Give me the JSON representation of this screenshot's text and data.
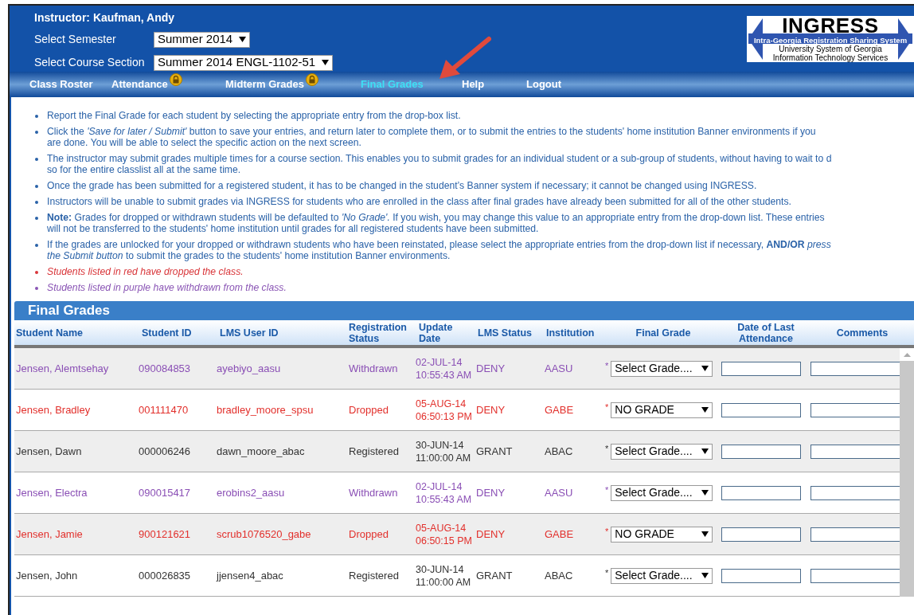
{
  "header": {
    "instructor": "Instructor: Kaufman, Andy",
    "semester_label": "Select Semester",
    "semester_value": "Summer 2014",
    "section_label": "Select Course Section",
    "section_value": "Summer 2014 ENGL-1102-51"
  },
  "logo": {
    "title": "INGRESS",
    "subtitle": "Intra-Georgia Registration Sharing System",
    "line_1": "University System of Georgia",
    "line_2": "Information Technology Services"
  },
  "nav": [
    {
      "label": "Class Roster",
      "selected": false,
      "locked": false
    },
    {
      "label": "Attendance",
      "selected": false,
      "locked": true
    },
    {
      "label": "Midterm Grades",
      "selected": false,
      "locked": true
    },
    {
      "label": "Final Grades",
      "selected": true,
      "locked": false
    },
    {
      "label": "Help",
      "selected": false,
      "locked": false
    },
    {
      "label": "Logout",
      "selected": false,
      "locked": false
    }
  ],
  "instructions": [
    {
      "kind": "info",
      "lines": [
        "Report the Final Grade for each student by selecting the appropriate entry from the drop-box list."
      ]
    },
    {
      "kind": "info",
      "lines": [
        "Click the *'Save for later / Submit'* button to save your entries, and return later to complete them, or to submit the entries to the students' home institution Banner environments if you",
        "are done. You will be able to select the specific action on the next screen."
      ]
    },
    {
      "kind": "info",
      "lines": [
        "The instructor may submit grades multiple times for a course section. This enables you to submit grades for an individual student or a sub-group of students, without having to wait to d",
        "so for the entire classlist all at the same time."
      ]
    },
    {
      "kind": "info",
      "lines": [
        "Once the grade has been submitted for a registered student, it has to be changed in the student’s Banner system if necessary; it cannot be changed using INGRESS."
      ]
    },
    {
      "kind": "info",
      "lines": [
        "Instructors will be unable to submit grades via INGRESS for students who are enrolled in the class after final grades have already been submitted for all of the other students."
      ]
    },
    {
      "kind": "info",
      "lines": [
        "**Note:** Grades for dropped or withdrawn students will be defaulted to *'No Grade'.* If you wish, you may change this value to an appropriate entry from the drop-down list. These entries",
        "will not be transferred to the students' home institution until grades for all registered students have been submitted."
      ]
    },
    {
      "kind": "info",
      "lines": [
        "If the grades are unlocked for your dropped or withdrawn students who have been reinstated, please select the appropriate entries from the drop-down list if necessary, **AND/OR** *press*",
        "*the Submit button* to submit the grades to the students' home institution Banner environments."
      ]
    },
    {
      "kind": "dropped",
      "lines": [
        "Students listed in red have dropped the class."
      ]
    },
    {
      "kind": "withdrawn",
      "lines": [
        "Students listed in purple have withdrawn from the class."
      ]
    }
  ],
  "table": {
    "title": "Final Grades",
    "columns": [
      "Student Name",
      "Student ID",
      "LMS User ID",
      "Registration Status",
      "Update Date",
      "LMS Status",
      "Institution",
      "Final Grade",
      "Date of Last Attendance",
      "Comments"
    ],
    "rows": [
      {
        "kind": "withdrawn",
        "name": "Jensen, Alemtsehay",
        "student_id": "090084853",
        "lms_user_id": "ayebiyo_aasu",
        "registration_status": "Withdrawn",
        "update_date": "02-JUL-14 10:55:43 AM",
        "lms_status": "DENY",
        "institution": "AASU",
        "required": "*",
        "final_grade": "Select Grade...."
      },
      {
        "kind": "dropped",
        "name": "Jensen, Bradley",
        "student_id": "001111470",
        "lms_user_id": "bradley_moore_spsu",
        "registration_status": "Dropped",
        "update_date": "05-AUG-14 06:50:13 PM",
        "lms_status": "DENY",
        "institution": "GABE",
        "required": "*",
        "final_grade": "NO GRADE"
      },
      {
        "kind": "registered",
        "name": "Jensen, Dawn",
        "student_id": "000006246",
        "lms_user_id": "dawn_moore_abac",
        "registration_status": "Registered",
        "update_date": "30-JUN-14 11:00:00 AM",
        "lms_status": "GRANT",
        "institution": "ABAC",
        "required": "*",
        "final_grade": "Select Grade...."
      },
      {
        "kind": "withdrawn",
        "name": "Jensen, Electra",
        "student_id": "090015417",
        "lms_user_id": "erobins2_aasu",
        "registration_status": "Withdrawn",
        "update_date": "02-JUL-14 10:55:43 AM",
        "lms_status": "DENY",
        "institution": "AASU",
        "required": "*",
        "final_grade": "Select Grade...."
      },
      {
        "kind": "dropped",
        "name": "Jensen, Jamie",
        "student_id": "900121621",
        "lms_user_id": "scrub1076520_gabe",
        "registration_status": "Dropped",
        "update_date": "05-AUG-14 06:50:15 PM",
        "lms_status": "DENY",
        "institution": "GABE",
        "required": "*",
        "final_grade": "NO GRADE"
      },
      {
        "kind": "registered",
        "name": "Jensen, John",
        "student_id": "000026835",
        "lms_user_id": "jjensen4_abac",
        "registration_status": "Registered",
        "update_date": "30-JUN-14 11:00:00 AM",
        "lms_status": "GRANT",
        "institution": "ABAC",
        "required": "*",
        "final_grade": "Select Grade...."
      }
    ]
  }
}
